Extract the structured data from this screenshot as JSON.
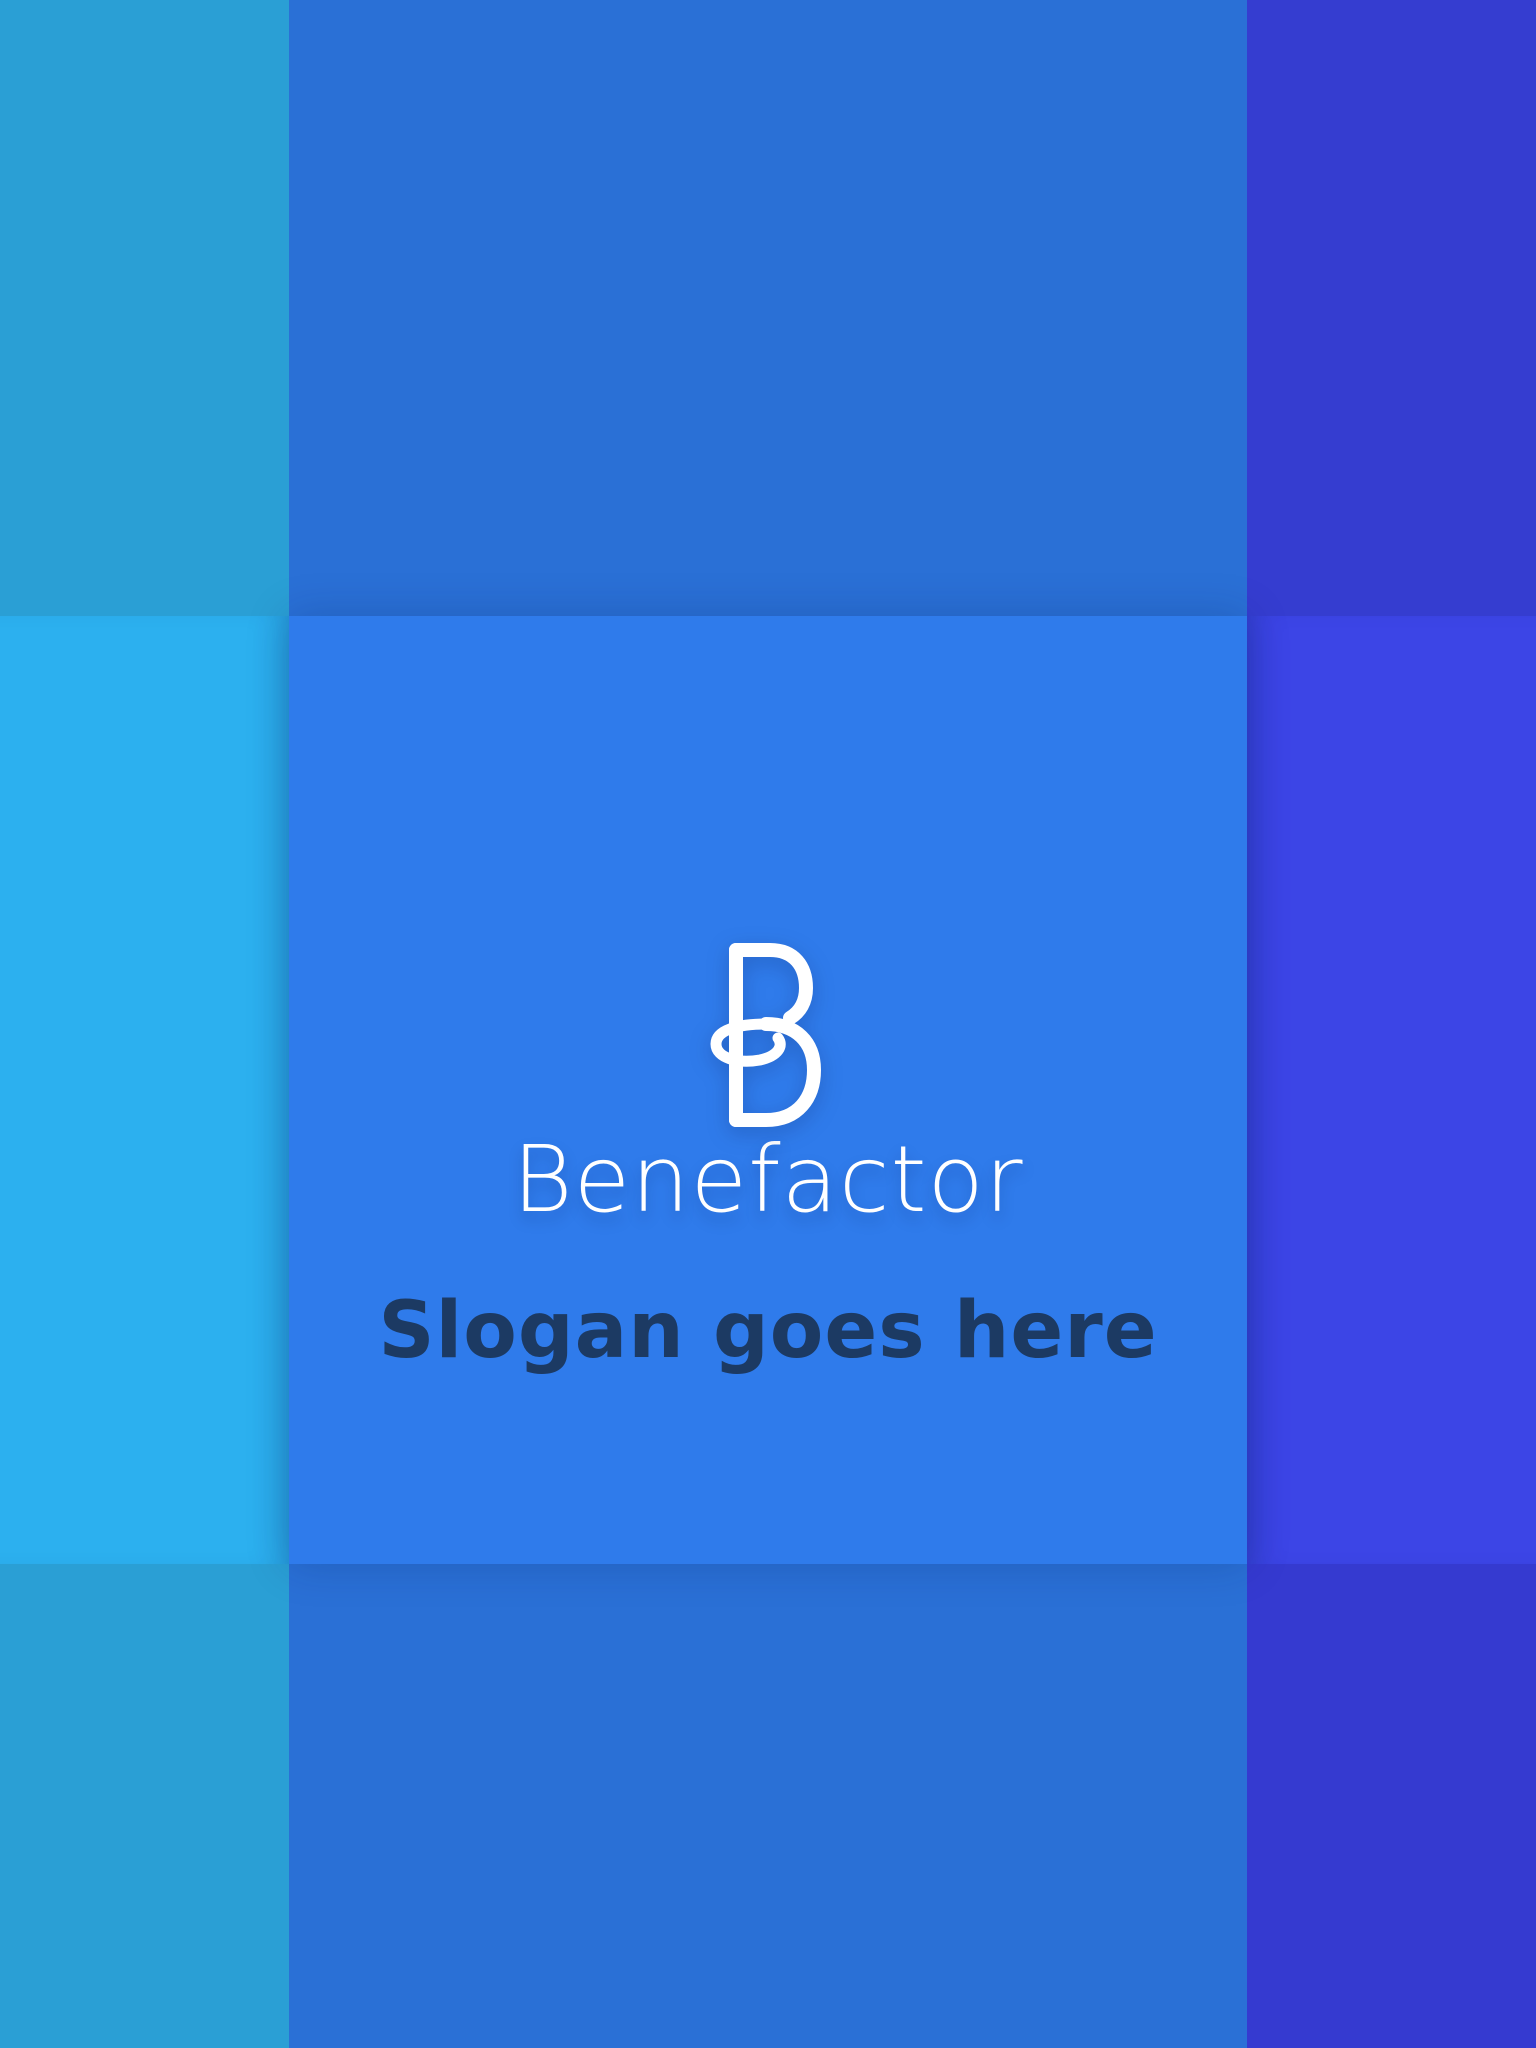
{
  "splash": {
    "brand_name": "Benefactor",
    "logo_icon": "benefactor-b-logo-icon",
    "slogan": "Slogan goes here"
  },
  "colors": {
    "top_left": "#2a9fd5",
    "top_mid": "#2a70d6",
    "top_right": "#353dd0",
    "mid_left": "#2cb0ef",
    "mid_mid": "#2f7beb",
    "mid_right": "#3c45e6",
    "bottom_left": "#2a9fd5",
    "bottom_mid": "#2a70d6",
    "bottom_right": "#353ad0",
    "logo": "#ffffff",
    "slogan_text": "#1c3a63"
  }
}
